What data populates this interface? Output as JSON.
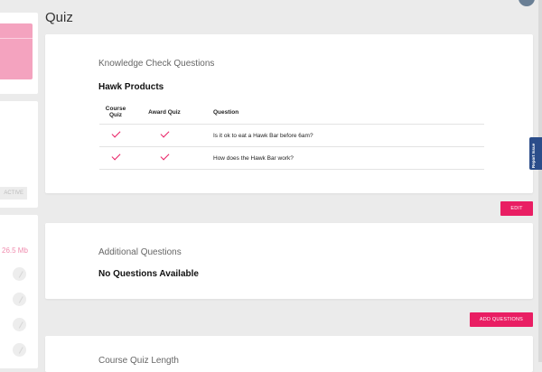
{
  "page": {
    "title": "Quiz"
  },
  "left_panel": {
    "file_size": "26.5 Mb",
    "pill_label": "ACTIVE"
  },
  "knowledge_check": {
    "title": "Knowledge Check Questions",
    "group": "Hawk Products",
    "columns": [
      "Course Quiz",
      "Award Quiz",
      "Question"
    ],
    "rows": [
      {
        "course_quiz": true,
        "award_quiz": true,
        "question": "Is it ok to eat a Hawk Bar before 6am?"
      },
      {
        "course_quiz": true,
        "award_quiz": true,
        "question": "How does the Hawk Bar work?"
      }
    ],
    "edit_label": "EDIT"
  },
  "additional": {
    "title": "Additional Questions",
    "empty_message": "No Questions Available",
    "add_label": "ADD QUESTIONS"
  },
  "quiz_length": {
    "title": "Course Quiz Length"
  },
  "report_tab": {
    "label": "Report Issue"
  },
  "colors": {
    "accent": "#e91e63",
    "report_tab": "#2b4d8a",
    "pink_block": "#f4a3bf"
  },
  "icons": {
    "check": "check-icon",
    "circle": "circle-check-icon"
  }
}
